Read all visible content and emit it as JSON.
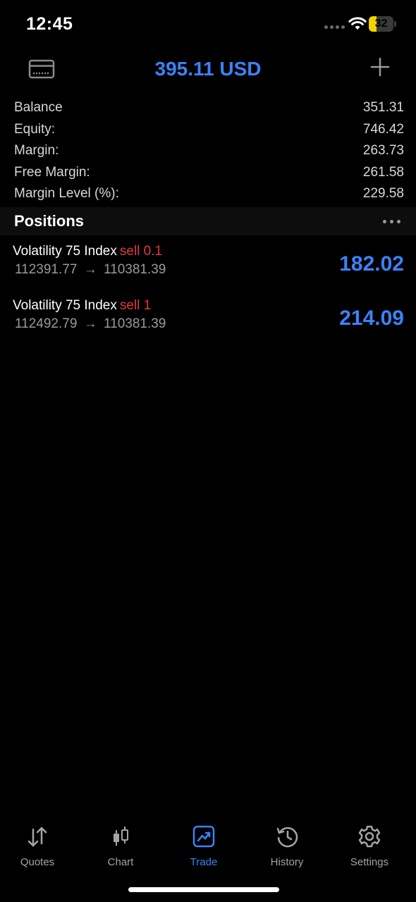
{
  "status_bar": {
    "time": "12:45",
    "battery_level": "32",
    "battery_fraction": 0.32,
    "battery_color": "#f2d200"
  },
  "header": {
    "title": "395.11 USD",
    "left_icon": "card-icon",
    "right_icon": "plus-icon",
    "accent_color": "#3b82f6"
  },
  "summary": [
    {
      "label": "Balance",
      "value": "351.31"
    },
    {
      "label": "Equity:",
      "value": "746.42"
    },
    {
      "label": "Margin:",
      "value": "263.73"
    },
    {
      "label": "Free Margin:",
      "value": "261.58"
    },
    {
      "label": "Margin Level (%):",
      "value": "229.58"
    }
  ],
  "positions": {
    "title": "Positions",
    "menu_icon": "more-icon",
    "items": [
      {
        "symbol": "Volatility 75 Index",
        "side": "sell",
        "volume": "0.1",
        "open_price": "112391.77",
        "arrow": "→",
        "current_price": "110381.39",
        "profit": "182.02"
      },
      {
        "symbol": "Volatility 75 Index",
        "side": "sell",
        "volume": "1",
        "open_price": "112492.79",
        "arrow": "→",
        "current_price": "110381.39",
        "profit": "214.09"
      }
    ],
    "sell_color": "#e0393e"
  },
  "tab_bar": {
    "active": "Trade",
    "tabs": [
      {
        "label": "Quotes",
        "icon": "sort-arrows-icon"
      },
      {
        "label": "Chart",
        "icon": "candlestick-icon"
      },
      {
        "label": "Trade",
        "icon": "trade-chart-icon"
      },
      {
        "label": "History",
        "icon": "history-icon"
      },
      {
        "label": "Settings",
        "icon": "gear-icon"
      }
    ]
  }
}
